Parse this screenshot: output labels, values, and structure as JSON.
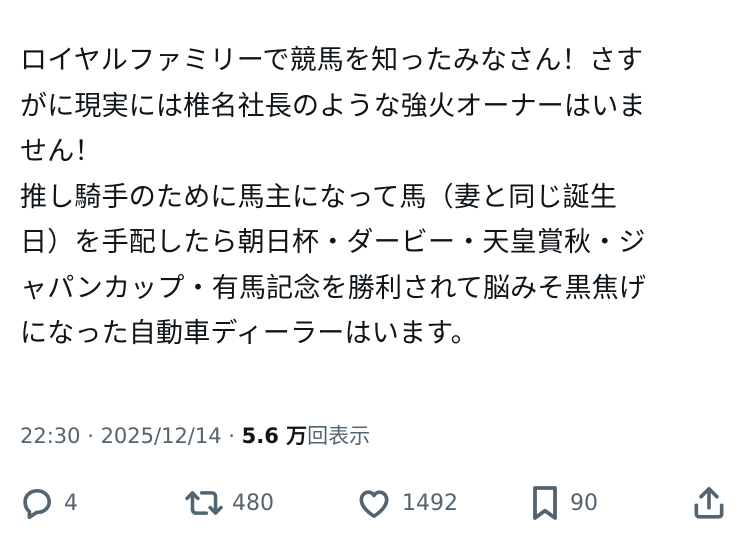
{
  "tweet": {
    "lines": [
      "ロイヤルファミリーで競馬を知ったみなさん！さす",
      "がに現実には椎名社長のような強火オーナーはいま",
      "せん！",
      "推し騎手のために馬主になって馬（妻と同じ誕生",
      "日）を手配したら朝日杯・ダービー・天皇賞秋・ジ",
      "ャパンカップ・有馬記念を勝利されて脳みそ黒焦げ",
      "になった自動車ディーラーはいます。"
    ]
  },
  "meta": {
    "time": "22:30",
    "separator": " · ",
    "date": "2025/12/14",
    "views_count": "5.6 万",
    "views_label": "回表示"
  },
  "actions": {
    "reply": {
      "icon": "reply-icon",
      "count": "4"
    },
    "retweet": {
      "icon": "retweet-icon",
      "count": "480"
    },
    "like": {
      "icon": "heart-icon",
      "count": "1492"
    },
    "bookmark": {
      "icon": "bookmark-icon",
      "count": "90"
    },
    "share": {
      "icon": "share-icon"
    }
  },
  "colors": {
    "text": "#0f1419",
    "secondary": "#536471",
    "background": "#ffffff"
  }
}
